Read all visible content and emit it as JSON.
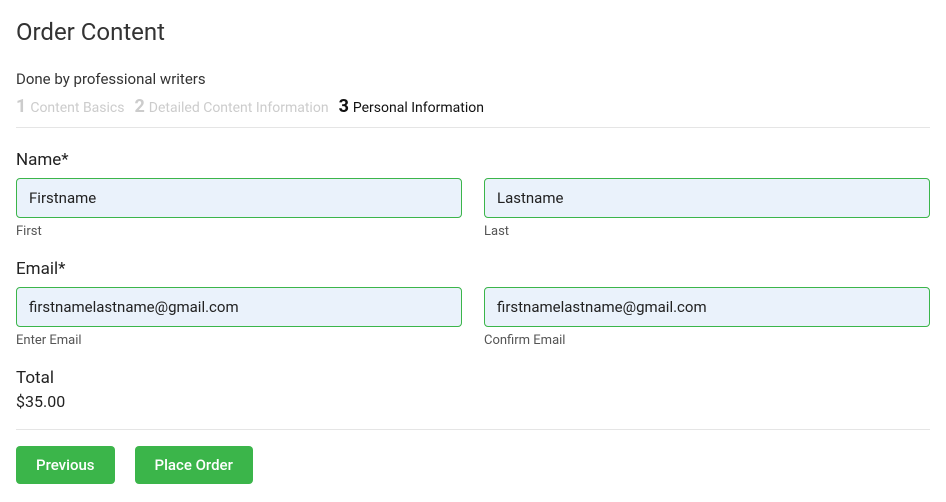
{
  "page": {
    "title": "Order Content",
    "subtitle": "Done by professional writers"
  },
  "steps": [
    {
      "num": "1",
      "label": "Content Basics",
      "active": false
    },
    {
      "num": "2",
      "label": "Detailed Content Information",
      "active": false
    },
    {
      "num": "3",
      "label": "Personal Information",
      "active": true
    }
  ],
  "form": {
    "name_label": "Name*",
    "first_name": {
      "value": "Firstname",
      "help": "First"
    },
    "last_name": {
      "value": "Lastname",
      "help": "Last"
    },
    "email_label": "Email*",
    "email": {
      "value": "firstnamelastname@gmail.com",
      "help": "Enter Email"
    },
    "confirm_email": {
      "value": "firstnamelastname@gmail.com",
      "help": "Confirm Email"
    }
  },
  "total": {
    "label": "Total",
    "value": "$35.00"
  },
  "buttons": {
    "previous": "Previous",
    "place_order": "Place Order"
  }
}
